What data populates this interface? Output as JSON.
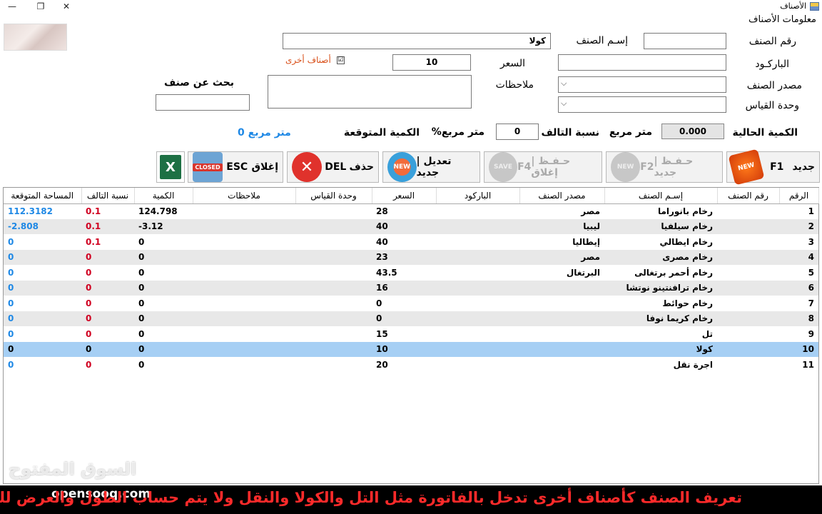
{
  "window": {
    "title": "الأصناف",
    "min": "—",
    "max": "❐",
    "close": "✕"
  },
  "form": {
    "group_label": "معلومات الأصناف",
    "item_no_label": "رقم الصنف",
    "item_name_label": "إسـم الصنف",
    "item_name_value": "كولا",
    "barcode_label": "الباركـود",
    "price_label": "السعر",
    "price_value": "10",
    "other_items_label": "أصناف أخرى",
    "other_items_checked": "☑",
    "source_label": "مصدر الصنف",
    "notes_label": "ملاحظات",
    "unit_label": "وحدة القياس",
    "search_label": "بحث عن صنف",
    "current_qty_label": "الكمية الحالية",
    "current_qty_value": "0.000",
    "sqm_label": "متر مربع",
    "waste_label": "نسبة التالف",
    "waste_value": "0",
    "percent_sqm_label": "%متر مربع",
    "expected_qty_label": "الكمية المتوقعة",
    "expected_value": "0 متر مربع"
  },
  "buttons": {
    "new": {
      "label": "جديد",
      "key": "F1",
      "badge": "NEW"
    },
    "save_new": {
      "label": "حـفـظ | جديد",
      "key": "F2"
    },
    "save_close": {
      "label": "حـفـظ | إغلاق",
      "key": "F4",
      "badge": "SAVE"
    },
    "edit_new": {
      "label": "تعديل | جديد",
      "badge": "NEW"
    },
    "delete": {
      "label": "حذف",
      "key": "DEL",
      "badge": "✕"
    },
    "close": {
      "label": "إغلاق",
      "key": "ESC",
      "badge": "CLOSED"
    },
    "excel": {
      "badge": "X"
    }
  },
  "table": {
    "headers": [
      "الرقم",
      "رقم الصنف",
      "إسـم الصنف",
      "مصدر الصنف",
      "الباركود",
      "السعر",
      "وحدة القياس",
      "ملاحظات",
      "الكمية",
      "نسبة التالف",
      "المساحة المتوقعة"
    ],
    "rows": [
      {
        "no": "1",
        "name": "رخام بانوراما",
        "source": "مصر",
        "price": "28",
        "qty": "124.798",
        "waste": "0.1",
        "area": "112.3182"
      },
      {
        "no": "2",
        "name": "رخام سيلفيا",
        "source": "ليبيا",
        "price": "40",
        "qty": "3.12-",
        "waste": "0.1",
        "area": "2.808-"
      },
      {
        "no": "3",
        "name": "رخام ايطالي",
        "source": "إيطاليا",
        "price": "40",
        "qty": "0",
        "waste": "0.1",
        "area": "0"
      },
      {
        "no": "4",
        "name": "رخام مصرى",
        "source": "مصر",
        "price": "23",
        "qty": "0",
        "waste": "0",
        "area": "0"
      },
      {
        "no": "5",
        "name": "رخام أحمر برتغالى",
        "source": "البرتغال",
        "price": "43.5",
        "qty": "0",
        "waste": "0",
        "area": "0"
      },
      {
        "no": "6",
        "name": "رخام ترافنتينو نوتشا",
        "source": "",
        "price": "16",
        "qty": "0",
        "waste": "0",
        "area": "0"
      },
      {
        "no": "7",
        "name": "رخام حوائط",
        "source": "",
        "price": "0",
        "qty": "0",
        "waste": "0",
        "area": "0"
      },
      {
        "no": "8",
        "name": "رخام كريما نوفا",
        "source": "",
        "price": "0",
        "qty": "0",
        "waste": "0",
        "area": "0"
      },
      {
        "no": "9",
        "name": "تل",
        "source": "",
        "price": "15",
        "qty": "0",
        "waste": "0",
        "area": "0"
      },
      {
        "no": "10",
        "name": "كولا",
        "source": "",
        "price": "10",
        "qty": "0",
        "waste": "0",
        "area": "0"
      },
      {
        "no": "11",
        "name": "اجرة نقل",
        "source": "",
        "price": "20",
        "qty": "0",
        "waste": "0",
        "area": "0"
      }
    ],
    "selected_row": "10"
  },
  "overlay": {
    "watermark": "السوق المفتوح",
    "brand": "opensooq.com",
    "caption": "تعريف الصنف كأصناف أخرى تدخل بالفاتورة مثل التل والكولا والنقل ولا يتم حساب الطول والعرض للصنف"
  }
}
